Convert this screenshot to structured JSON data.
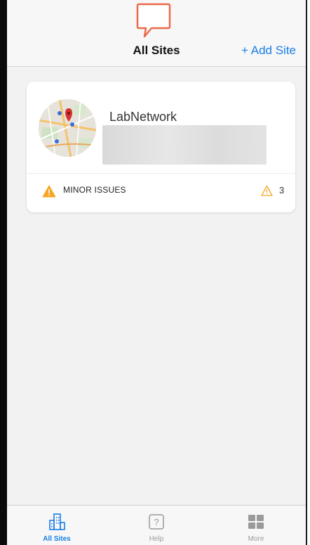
{
  "header": {
    "title": "All Sites",
    "add_site_label": "+ Add Site"
  },
  "sites": [
    {
      "name": "LabNetwork",
      "status": "MINOR ISSUES",
      "alert_count": "3"
    }
  ],
  "tabs": [
    {
      "label": "All Sites",
      "icon": "buildings-icon",
      "active": true
    },
    {
      "label": "Help",
      "icon": "help-icon",
      "active": false
    },
    {
      "label": "More",
      "icon": "grid-icon",
      "active": false
    }
  ],
  "colors": {
    "accent": "#1a7ee6",
    "warning": "#f5a623",
    "chat_icon": "#ea6a4a"
  }
}
